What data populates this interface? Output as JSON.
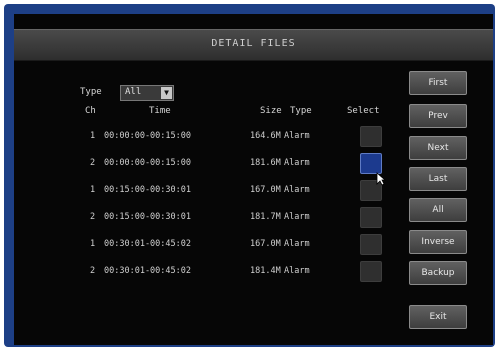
{
  "title": "DETAIL FILES",
  "filter": {
    "label": "Type",
    "value": "All"
  },
  "columns": {
    "ch": "Ch",
    "time": "Time",
    "size": "Size",
    "type": "Type",
    "select": "Select"
  },
  "rows": [
    {
      "ch": "1",
      "time": "00:00:00-00:15:00",
      "size": "164.6M",
      "type": "Alarm",
      "selected": false
    },
    {
      "ch": "2",
      "time": "00:00:00-00:15:00",
      "size": "181.6M",
      "type": "Alarm",
      "selected": true
    },
    {
      "ch": "1",
      "time": "00:15:00-00:30:01",
      "size": "167.0M",
      "type": "Alarm",
      "selected": false
    },
    {
      "ch": "2",
      "time": "00:15:00-00:30:01",
      "size": "181.7M",
      "type": "Alarm",
      "selected": false
    },
    {
      "ch": "1",
      "time": "00:30:01-00:45:02",
      "size": "167.0M",
      "type": "Alarm",
      "selected": false
    },
    {
      "ch": "2",
      "time": "00:30:01-00:45:02",
      "size": "181.4M",
      "type": "Alarm",
      "selected": false
    }
  ],
  "buttons": {
    "first": "First",
    "prev": "Prev",
    "next": "Next",
    "last": "Last",
    "all": "All",
    "inverse": "Inverse",
    "backup": "Backup",
    "exit": "Exit"
  },
  "colors": {
    "frame": "#1d3f86",
    "selected": "#1c3a8e"
  }
}
